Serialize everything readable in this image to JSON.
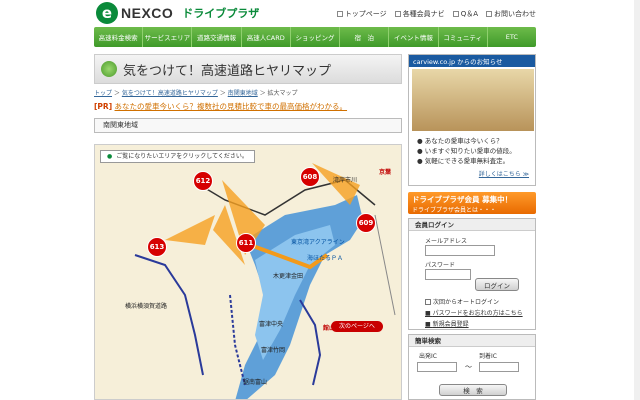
{
  "header": {
    "logo_letter": "e",
    "logo_brand": "NEXCO",
    "logo_sub": "ドライブプラザ",
    "util_links": [
      "トップページ",
      "各種会員ナビ",
      "Q＆A",
      "お問い合わせ"
    ]
  },
  "nav": [
    "高速料金検索",
    "サービスエリア",
    "道路交通情報",
    "高速人CARD",
    "ショッピング",
    "宿　泊",
    "イベント情報",
    "コミュニティ",
    "ETC"
  ],
  "page": {
    "title": "気をつけて！高速道路ヒヤリマップ",
    "breadcrumb": [
      "トップ",
      "気をつけて！高速道路ヒヤリマップ",
      "南関東地域",
      "拡大マップ"
    ],
    "pr_tag": "[PR]",
    "pr_text": "あなたの愛車今いくら？複数社の見積比較で車の最高価格がわかる。",
    "region": "南関東地域"
  },
  "map": {
    "instruction": "ご覧になりたいエリアをクリックしてください。",
    "pins": [
      "612",
      "608",
      "613",
      "611",
      "609"
    ],
    "labels": [
      "京葉",
      "東京湾アクアライン",
      "海ほたるＰＡ",
      "木更津金田",
      "館山自動車道",
      "横浜横須賀道路",
      "湾岸市川",
      "富津竹岡",
      "富津中央",
      "鋸南富山"
    ],
    "next_page": "次のページへ"
  },
  "sidebar": {
    "ad_title": "carview.co.jp からのお知らせ",
    "ad_items": [
      "あなたの愛車は今いくら？",
      "いますぐ知りたい愛車の値段。",
      "気軽にできる愛車無料査定。"
    ],
    "ad_more": "詳しくはこちら ≫",
    "member_title": "ドライブプラザ会員 募集中！",
    "member_sub": "ドライブプラザ会員とは・・・",
    "login_title": "会員ログイン",
    "mail_label": "メールアドレス",
    "pass_label": "パスワード",
    "login_btn": "ログイン",
    "auto_login": "次回からオートログイン",
    "forgot": "パスワードをお忘れの方はこちら",
    "register": "新規会員登録",
    "search_title": "簡単検索",
    "from_label": "出発IC",
    "to_label": "到着IC",
    "tilde": "〜",
    "search_btn": "検　索"
  },
  "colors": {
    "nav_green": "#3f9a2a",
    "pin_red": "#d60000",
    "accent_orange": "#e86a00",
    "sea_blue": "#5fa0d8",
    "highway_orange": "#f39a1a"
  }
}
